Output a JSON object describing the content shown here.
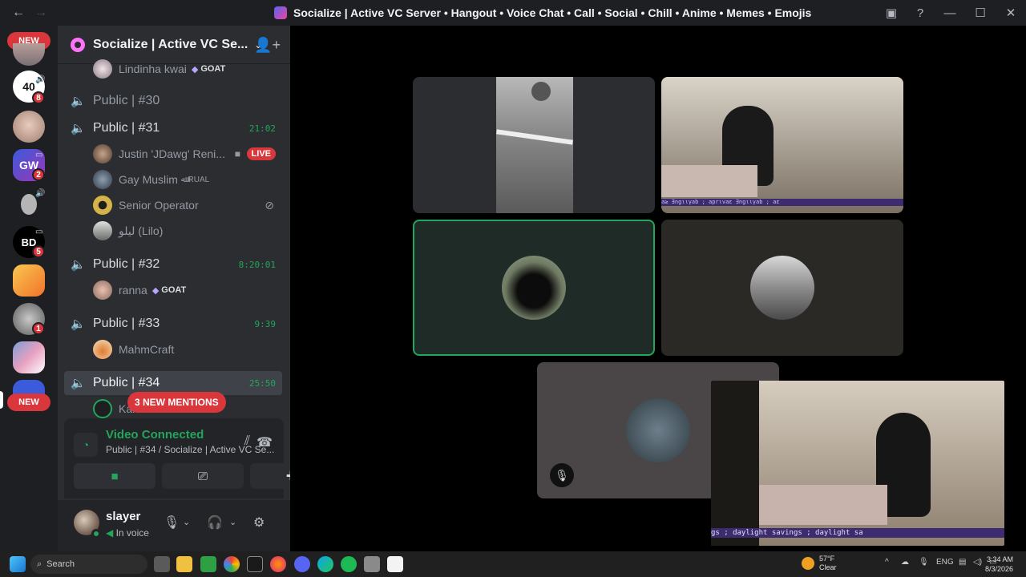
{
  "window": {
    "title": "Socialize | Active VC Server • Hangout • Voice Chat • Call • Social • Chill • Anime • Memes • Emojis",
    "back_icon": "←",
    "forward_icon": "→"
  },
  "guilds": {
    "new_top": "NEW",
    "new_bottom": "NEW",
    "badges": [
      "8",
      "2",
      "5",
      "1"
    ]
  },
  "server": {
    "name": "Socialize | Active VC Se...",
    "chevron": "⌄",
    "invite": "👤+"
  },
  "channels": {
    "top_member": {
      "name": "Lindinha kwai",
      "tag": "GOAT"
    },
    "c30": {
      "name": "Public | #30"
    },
    "c31": {
      "name": "Public | #31",
      "timer": "21:02",
      "members": [
        {
          "name": "Justin 'JDawg' Reni...",
          "live": "LIVE"
        },
        {
          "name": "Gay Muslim",
          "suffix": "ﷲ RUAL"
        },
        {
          "name": "Senior Operator"
        },
        {
          "name": "ليلو (Lilo)"
        }
      ]
    },
    "c32": {
      "name": "Public | #32",
      "timer": "8:20:01",
      "members": [
        {
          "name": "ranna",
          "tag": "GOAT"
        }
      ]
    },
    "c33": {
      "name": "Public | #33",
      "timer": "9:39",
      "members": [
        {
          "name": "MahmCraft"
        }
      ]
    },
    "c34": {
      "name": "Public | #34",
      "timer": "25:50",
      "members": [
        {
          "name": "Kanme"
        }
      ]
    },
    "mentions": "3 NEW MENTIONS"
  },
  "rtc": {
    "status": "Video Connected",
    "subtitle": "Public | #34 / Socialize | Active VC Se..."
  },
  "user": {
    "name": "slayer",
    "status": "In voice"
  },
  "stage": {
    "overlay_text_top": "a≥ ∃ngιιγаb          ; aprιvaε ∃ngιιγаb          ; aε",
    "overlay_text_bottom": "gs ;        daylight savings ;        daylight sa"
  },
  "taskbar": {
    "search_label": "Search",
    "weather_temp": "57°F",
    "weather_desc": "Clear",
    "lang": "ENG",
    "time": "3:34 AM",
    "date": "8/3/2026"
  },
  "colors": {
    "accent_green": "#23a55a",
    "alert_red": "#da373c",
    "sidebar_bg": "#2b2d31",
    "guild_bg": "#1e1f22"
  }
}
